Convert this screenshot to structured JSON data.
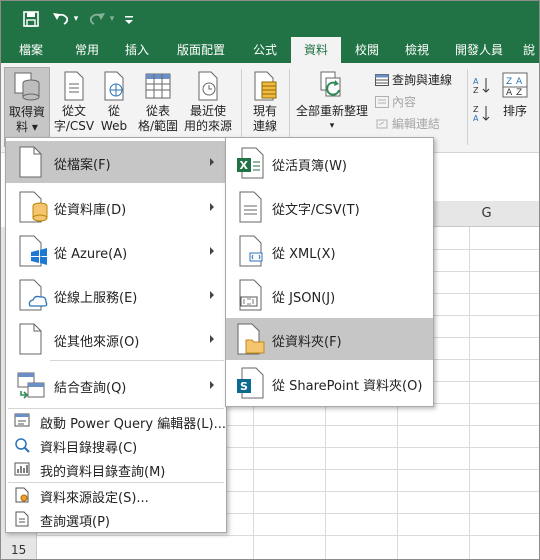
{
  "quick_access": {
    "save_icon": "save-icon",
    "undo_icon": "undo-icon",
    "redo_icon": "redo-icon",
    "customize_icon": "customize-icon"
  },
  "tabs": [
    "檔案",
    "常用",
    "插入",
    "版面配置",
    "公式",
    "資料",
    "校閱",
    "檢視",
    "開發人員",
    "說"
  ],
  "active_tab": "資料",
  "ribbon": {
    "get_data": {
      "line1": "取得資",
      "line2": "料 ▾"
    },
    "from_text": {
      "line1": "從文",
      "line2": "字/CSV"
    },
    "from_web": {
      "line1": "從",
      "line2": "Web"
    },
    "from_table": {
      "line1": "從表",
      "line2": "格/範圍"
    },
    "recent_sources": {
      "line1": "最近使",
      "line2": "用的來源"
    },
    "existing_connections": {
      "line1": "現有",
      "line2": "連線"
    },
    "refresh_all": {
      "line1": "全部重新整理",
      "line2": "▾"
    },
    "queries_connections": "查詢與連線",
    "properties": "內容",
    "edit_links": "編輯連結",
    "sort_label": "排序"
  },
  "grid": {
    "column_label": "G",
    "row_label": "15"
  },
  "main_menu": {
    "items": [
      {
        "label": "從檔案(F)",
        "icon": "file-icon",
        "submenu": true,
        "highlighted": true
      },
      {
        "label": "從資料庫(D)",
        "icon": "database-icon",
        "submenu": true
      },
      {
        "label": "從 Azure(A)",
        "icon": "azure-icon",
        "submenu": true
      },
      {
        "label": "從線上服務(E)",
        "icon": "cloud-icon",
        "submenu": true
      },
      {
        "label": "從其他來源(O)",
        "icon": "other-sources-icon",
        "submenu": true
      },
      {
        "label": "結合查詢(Q)",
        "icon": "combine-queries-icon",
        "submenu": true
      }
    ],
    "small_items": [
      {
        "label": "啟動 Power Query 編輯器(L)...",
        "icon": "power-query-editor-icon"
      },
      {
        "label": "資料目錄搜尋(C)",
        "icon": "catalog-search-icon"
      },
      {
        "label": "我的資料目錄查詢(M)",
        "icon": "my-catalog-queries-icon"
      },
      {
        "label": "資料來源設定(S)...",
        "icon": "data-source-settings-icon"
      },
      {
        "label": "查詢選項(P)",
        "icon": "query-options-icon"
      }
    ]
  },
  "submenu": {
    "items": [
      {
        "label": "從活頁簿(W)",
        "icon": "excel-workbook-icon"
      },
      {
        "label": "從文字/CSV(T)",
        "icon": "text-file-icon"
      },
      {
        "label": "從 XML(X)",
        "icon": "xml-file-icon"
      },
      {
        "label": "從 JSON(J)",
        "icon": "json-file-icon"
      },
      {
        "label": "從資料夾(F)",
        "icon": "folder-icon",
        "highlighted": true
      },
      {
        "label": "從 SharePoint 資料夾(O)",
        "icon": "sharepoint-folder-icon"
      }
    ]
  },
  "colors": {
    "excel_green": "#217346",
    "highlight": "#c6c6c6",
    "ribbon_bg": "#f3f3f3"
  }
}
